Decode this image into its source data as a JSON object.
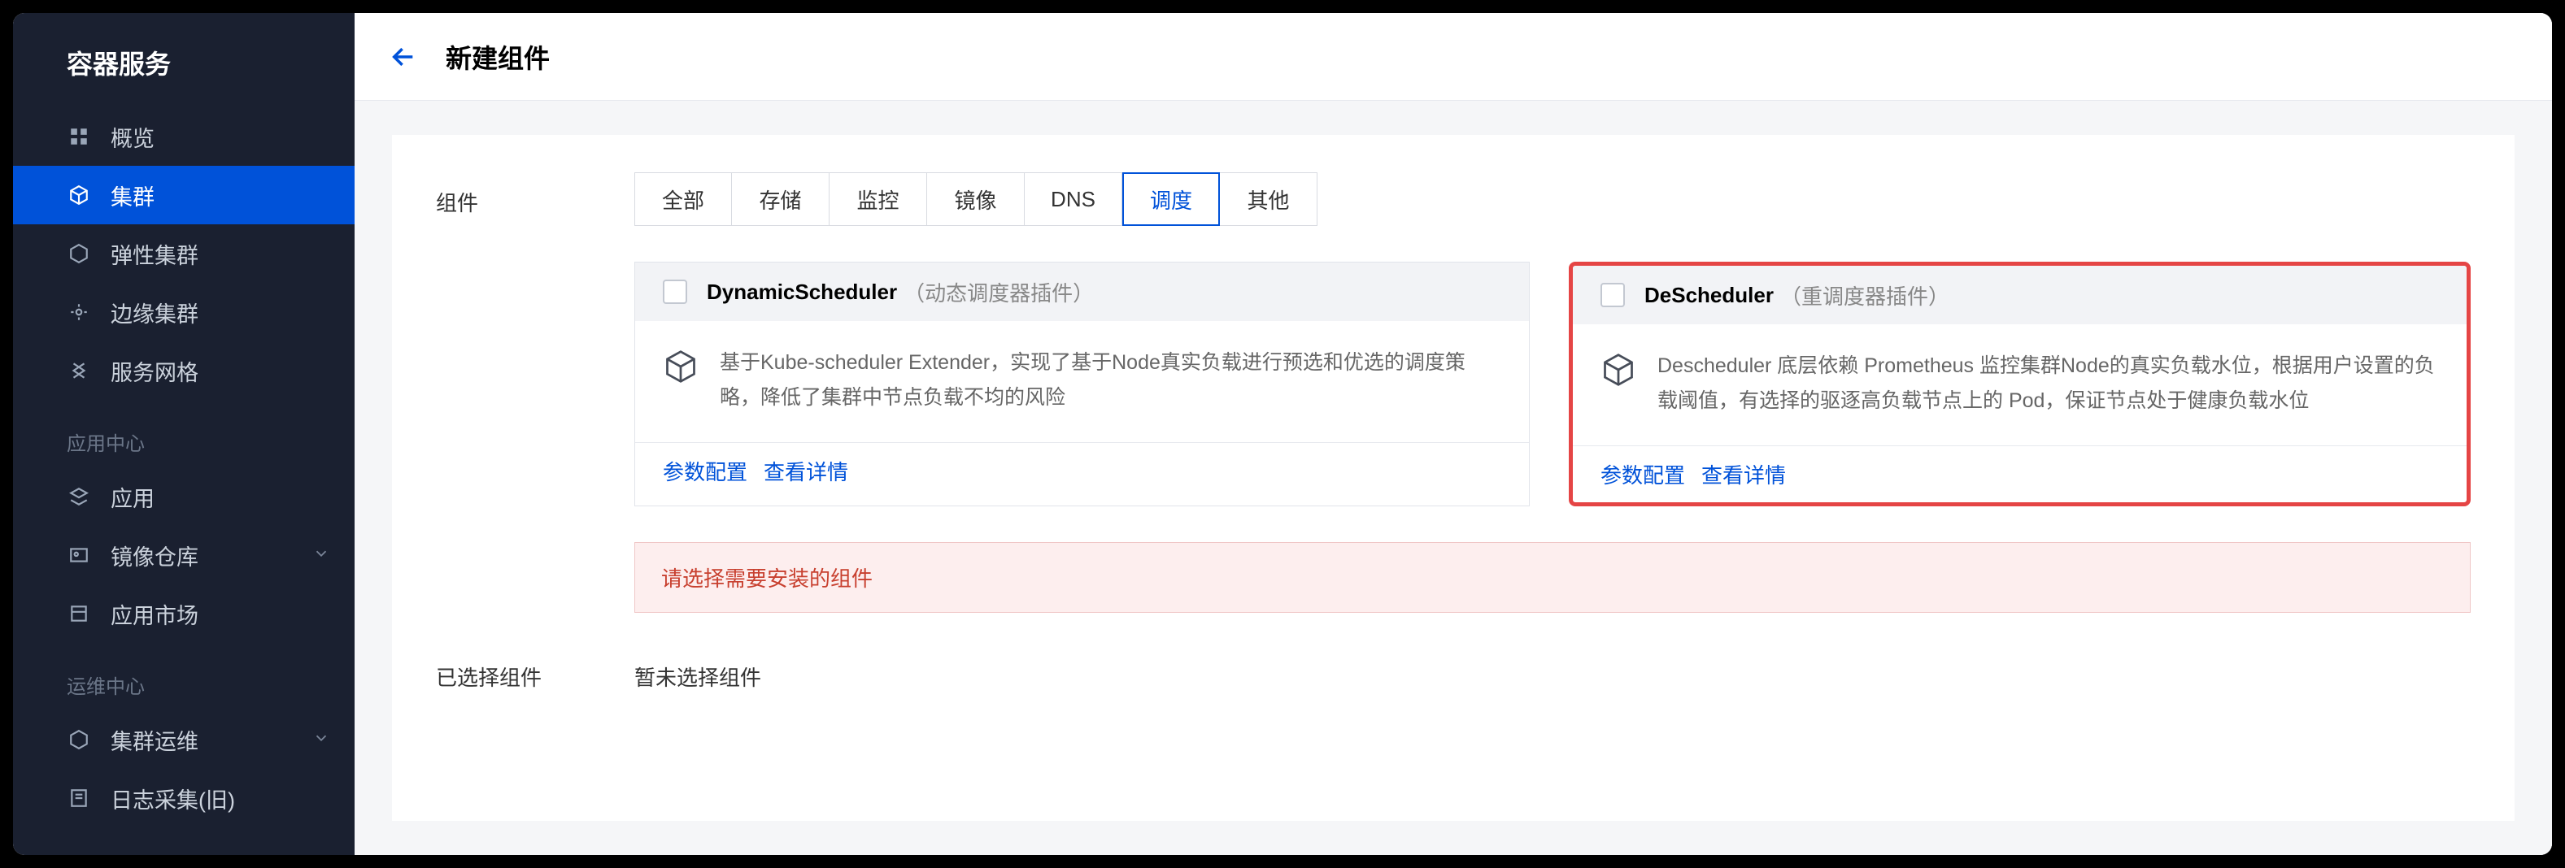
{
  "brand": "容器服务",
  "sidebar": {
    "items": [
      {
        "label": "概览"
      },
      {
        "label": "集群"
      },
      {
        "label": "弹性集群"
      },
      {
        "label": "边缘集群"
      },
      {
        "label": "服务网格"
      }
    ],
    "group1_title": "应用中心",
    "group1_items": [
      {
        "label": "应用"
      },
      {
        "label": "镜像仓库",
        "expandable": true
      },
      {
        "label": "应用市场"
      }
    ],
    "group2_title": "运维中心",
    "group2_items": [
      {
        "label": "集群运维",
        "expandable": true
      },
      {
        "label": "日志采集(旧)"
      }
    ]
  },
  "header": {
    "title": "新建组件"
  },
  "form": {
    "label_component": "组件",
    "label_selected": "已选择组件",
    "selected_empty": "暂未选择组件"
  },
  "tabs": [
    "全部",
    "存储",
    "监控",
    "镜像",
    "DNS",
    "调度",
    "其他"
  ],
  "active_tab_index": 5,
  "cards": [
    {
      "name": "DynamicScheduler",
      "suffix": "（动态调度器插件）",
      "desc": "基于Kube-scheduler Extender，实现了基于Node真实负载进行预选和优选的调度策略，降低了集群中节点负载不均的风险",
      "links": [
        "参数配置",
        "查看详情"
      ]
    },
    {
      "name": "DeScheduler",
      "suffix": "（重调度器插件）",
      "desc": "Descheduler 底层依赖 Prometheus 监控集群Node的真实负载水位，根据用户设置的负载阈值，有选择的驱逐高负载节点上的 Pod，保证节点处于健康负载水位",
      "links": [
        "参数配置",
        "查看详情"
      ],
      "highlight": true
    }
  ],
  "error": "请选择需要安装的组件",
  "colors": {
    "accent": "#0052d9",
    "danger": "#e54545"
  }
}
